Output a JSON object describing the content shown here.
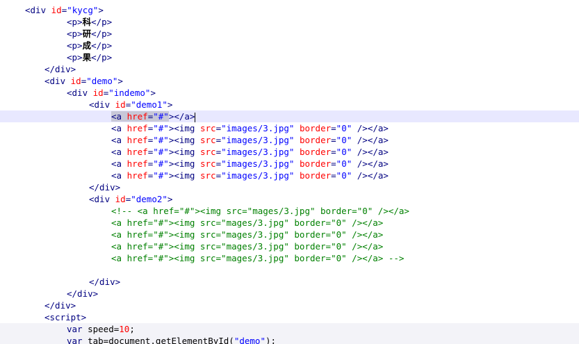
{
  "editor": {
    "lines": [
      {
        "indent": 36,
        "segments": [
          {
            "c": "tag",
            "t": "<div"
          },
          {
            "c": "attr",
            "t": " id"
          },
          {
            "c": "tag",
            "t": "="
          },
          {
            "c": "str",
            "t": "\"kycg\""
          },
          {
            "c": "tag",
            "t": ">"
          }
        ]
      },
      {
        "indent": 96,
        "segments": [
          {
            "c": "tag",
            "t": "<p>"
          },
          {
            "c": "cjk",
            "t": "科"
          },
          {
            "c": "tag",
            "t": "</p>"
          }
        ]
      },
      {
        "indent": 96,
        "segments": [
          {
            "c": "tag",
            "t": "<p>"
          },
          {
            "c": "cjk",
            "t": "研"
          },
          {
            "c": "tag",
            "t": "</p>"
          }
        ]
      },
      {
        "indent": 96,
        "segments": [
          {
            "c": "tag",
            "t": "<p>"
          },
          {
            "c": "cjk",
            "t": "成"
          },
          {
            "c": "tag",
            "t": "</p>"
          }
        ]
      },
      {
        "indent": 96,
        "segments": [
          {
            "c": "tag",
            "t": "<p>"
          },
          {
            "c": "cjk",
            "t": "果"
          },
          {
            "c": "tag",
            "t": "</p>"
          }
        ]
      },
      {
        "indent": 64,
        "segments": [
          {
            "c": "tag",
            "t": "</div>"
          }
        ]
      },
      {
        "indent": 64,
        "segments": [
          {
            "c": "tag",
            "t": "<div"
          },
          {
            "c": "attr",
            "t": " id"
          },
          {
            "c": "tag",
            "t": "="
          },
          {
            "c": "str",
            "t": "\"demo\""
          },
          {
            "c": "tag",
            "t": ">"
          }
        ]
      },
      {
        "indent": 96,
        "segments": [
          {
            "c": "tag",
            "t": "<div"
          },
          {
            "c": "attr",
            "t": " id"
          },
          {
            "c": "tag",
            "t": "="
          },
          {
            "c": "str",
            "t": "\"indemo\""
          },
          {
            "c": "tag",
            "t": ">"
          }
        ]
      },
      {
        "indent": 128,
        "segments": [
          {
            "c": "tag",
            "t": "<div"
          },
          {
            "c": "attr",
            "t": " id"
          },
          {
            "c": "tag",
            "t": "="
          },
          {
            "c": "str",
            "t": "\"demo1\""
          },
          {
            "c": "tag",
            "t": ">"
          }
        ]
      },
      {
        "indent": 160,
        "highlight": true,
        "segments": [
          {
            "c": "tag sel",
            "t": "<a"
          },
          {
            "c": "attr sel",
            "t": " href"
          },
          {
            "c": "tag sel",
            "t": "="
          },
          {
            "c": "str sel",
            "t": "\"#\""
          },
          {
            "c": "tag",
            "t": "></a>"
          },
          {
            "c": "caret",
            "t": ""
          }
        ]
      },
      {
        "indent": 160,
        "segments": [
          {
            "c": "tag",
            "t": "<a"
          },
          {
            "c": "attr",
            "t": " href"
          },
          {
            "c": "tag",
            "t": "="
          },
          {
            "c": "str",
            "t": "\"#\""
          },
          {
            "c": "tag",
            "t": "><img"
          },
          {
            "c": "attr",
            "t": " src"
          },
          {
            "c": "tag",
            "t": "="
          },
          {
            "c": "str",
            "t": "\"images/3.jpg\""
          },
          {
            "c": "attr",
            "t": " border"
          },
          {
            "c": "tag",
            "t": "="
          },
          {
            "c": "str",
            "t": "\"0\""
          },
          {
            "c": "tag",
            "t": " /></a>"
          }
        ]
      },
      {
        "indent": 160,
        "segments": [
          {
            "c": "tag",
            "t": "<a"
          },
          {
            "c": "attr",
            "t": " href"
          },
          {
            "c": "tag",
            "t": "="
          },
          {
            "c": "str",
            "t": "\"#\""
          },
          {
            "c": "tag",
            "t": "><img"
          },
          {
            "c": "attr",
            "t": " src"
          },
          {
            "c": "tag",
            "t": "="
          },
          {
            "c": "str",
            "t": "\"images/3.jpg\""
          },
          {
            "c": "attr",
            "t": " border"
          },
          {
            "c": "tag",
            "t": "="
          },
          {
            "c": "str",
            "t": "\"0\""
          },
          {
            "c": "tag",
            "t": " /></a>"
          }
        ]
      },
      {
        "indent": 160,
        "segments": [
          {
            "c": "tag",
            "t": "<a"
          },
          {
            "c": "attr",
            "t": " href"
          },
          {
            "c": "tag",
            "t": "="
          },
          {
            "c": "str",
            "t": "\"#\""
          },
          {
            "c": "tag",
            "t": "><img"
          },
          {
            "c": "attr",
            "t": " src"
          },
          {
            "c": "tag",
            "t": "="
          },
          {
            "c": "str",
            "t": "\"images/3.jpg\""
          },
          {
            "c": "attr",
            "t": " border"
          },
          {
            "c": "tag",
            "t": "="
          },
          {
            "c": "str",
            "t": "\"0\""
          },
          {
            "c": "tag",
            "t": " /></a>"
          }
        ]
      },
      {
        "indent": 160,
        "segments": [
          {
            "c": "tag",
            "t": "<a"
          },
          {
            "c": "attr",
            "t": " href"
          },
          {
            "c": "tag",
            "t": "="
          },
          {
            "c": "str",
            "t": "\"#\""
          },
          {
            "c": "tag",
            "t": "><img"
          },
          {
            "c": "attr",
            "t": " src"
          },
          {
            "c": "tag",
            "t": "="
          },
          {
            "c": "str",
            "t": "\"images/3.jpg\""
          },
          {
            "c": "attr",
            "t": " border"
          },
          {
            "c": "tag",
            "t": "="
          },
          {
            "c": "str",
            "t": "\"0\""
          },
          {
            "c": "tag",
            "t": " /></a>"
          }
        ]
      },
      {
        "indent": 160,
        "segments": [
          {
            "c": "tag",
            "t": "<a"
          },
          {
            "c": "attr",
            "t": " href"
          },
          {
            "c": "tag",
            "t": "="
          },
          {
            "c": "str",
            "t": "\"#\""
          },
          {
            "c": "tag",
            "t": "><img"
          },
          {
            "c": "attr",
            "t": " src"
          },
          {
            "c": "tag",
            "t": "="
          },
          {
            "c": "str",
            "t": "\"images/3.jpg\""
          },
          {
            "c": "attr",
            "t": " border"
          },
          {
            "c": "tag",
            "t": "="
          },
          {
            "c": "str",
            "t": "\"0\""
          },
          {
            "c": "tag",
            "t": " /></a>"
          }
        ]
      },
      {
        "indent": 128,
        "segments": [
          {
            "c": "tag",
            "t": "</div>"
          }
        ]
      },
      {
        "indent": 128,
        "segments": [
          {
            "c": "tag",
            "t": "<div"
          },
          {
            "c": "attr",
            "t": " id"
          },
          {
            "c": "tag",
            "t": "="
          },
          {
            "c": "str",
            "t": "\"demo2\""
          },
          {
            "c": "tag",
            "t": ">"
          }
        ]
      },
      {
        "indent": 160,
        "segments": [
          {
            "c": "cmt",
            "t": "<!-- <a href=\"#\"><img src=\"mages/3.jpg\" border=\"0\" /></a>"
          }
        ]
      },
      {
        "indent": 160,
        "segments": [
          {
            "c": "cmt",
            "t": "<a href=\"#\"><img src=\"mages/3.jpg\" border=\"0\" /></a>"
          }
        ]
      },
      {
        "indent": 160,
        "segments": [
          {
            "c": "cmt",
            "t": "<a href=\"#\"><img src=\"mages/3.jpg\" border=\"0\" /></a>"
          }
        ]
      },
      {
        "indent": 160,
        "segments": [
          {
            "c": "cmt",
            "t": "<a href=\"#\"><img src=\"mages/3.jpg\" border=\"0\" /></a>"
          }
        ]
      },
      {
        "indent": 160,
        "segments": [
          {
            "c": "cmt",
            "t": "<a href=\"#\"><img src=\"mages/3.jpg\" border=\"0\" /></a> -->"
          }
        ]
      },
      {
        "indent": 0,
        "segments": []
      },
      {
        "indent": 128,
        "segments": [
          {
            "c": "tag",
            "t": "</div>"
          }
        ]
      },
      {
        "indent": 96,
        "segments": [
          {
            "c": "tag",
            "t": "</div>"
          }
        ]
      },
      {
        "indent": 64,
        "segments": [
          {
            "c": "tag",
            "t": "</div>"
          }
        ]
      },
      {
        "indent": 64,
        "segments": [
          {
            "c": "tag",
            "t": "<script>"
          }
        ]
      },
      {
        "indent": 96,
        "soft": true,
        "segments": [
          {
            "c": "kw",
            "t": "var"
          },
          {
            "c": "txt",
            "t": " speed="
          },
          {
            "c": "num",
            "t": "10"
          },
          {
            "c": "txt",
            "t": ";"
          }
        ]
      },
      {
        "indent": 96,
        "soft": true,
        "segments": [
          {
            "c": "kw",
            "t": "var"
          },
          {
            "c": "txt",
            "t": " tab=document.getElementById("
          },
          {
            "c": "str",
            "t": "\"demo\""
          },
          {
            "c": "txt",
            "t": ");"
          }
        ]
      }
    ]
  }
}
